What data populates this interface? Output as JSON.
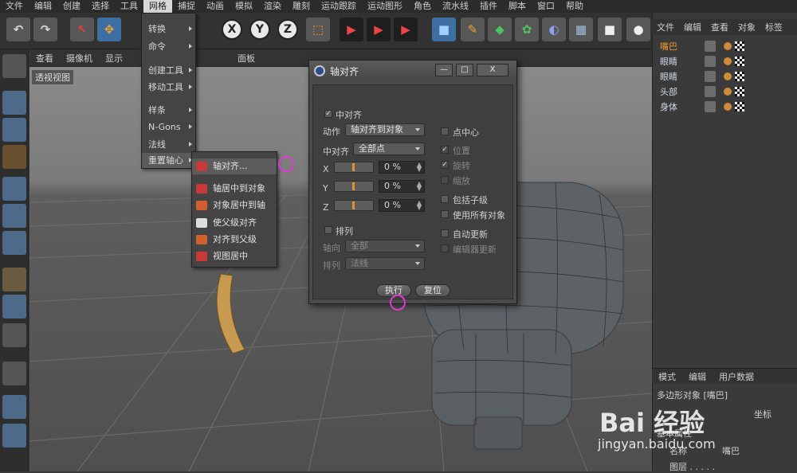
{
  "menubar": [
    "文件",
    "编辑",
    "创建",
    "选择",
    "工具",
    "网格",
    "捕捉",
    "动画",
    "模拟",
    "渲染",
    "雕刻",
    "运动跟踪",
    "运动图形",
    "角色",
    "流水线",
    "插件",
    "脚本",
    "窗口",
    "帮助"
  ],
  "toolbar": {
    "axis_x": "X",
    "axis_y": "Y",
    "axis_z": "Z"
  },
  "viewport": {
    "menu": [
      "查看",
      "摄像机",
      "显示",
      "面板"
    ],
    "label": "透视视图"
  },
  "mesh_menu": {
    "items": [
      "转换",
      "命令",
      "创建工具",
      "移动工具",
      "样条",
      "N-Gons",
      "法线",
      "重置轴心"
    ],
    "active": "重置轴心"
  },
  "submenu": {
    "items": [
      "轴对齐...",
      "轴居中到对象",
      "对象居中到轴",
      "使父级对齐",
      "对齐到父级",
      "视图居中"
    ]
  },
  "dialog": {
    "title": "轴对齐",
    "window_buttons": [
      "—",
      "□",
      "X"
    ],
    "center_align_label": "中对齐",
    "action_label": "动作",
    "action_value": "轴对齐到对象",
    "center_label": "中对齐",
    "center_value": "全部点",
    "x_label": "X",
    "y_label": "Y",
    "z_label": "Z",
    "x_value": "0 %",
    "y_value": "0 %",
    "z_value": "0 %",
    "arrange_label": "排列",
    "axis_label": "轴向",
    "axis_value": "全部",
    "arrange_row_label": "排列",
    "arrange_value": "法线",
    "point_center": "点中心",
    "position": "位置",
    "rotation": "旋转",
    "scale": "缩放",
    "include_children": "包括子级",
    "use_all_objects": "使用所有对象",
    "auto_update": "自动更新",
    "editor_update": "编辑器更新",
    "execute": "执行",
    "reset": "复位"
  },
  "right_panel": {
    "menu": [
      "文件",
      "编辑",
      "查看",
      "对象",
      "标签"
    ],
    "objects": [
      {
        "name": "嘴巴",
        "selected": true
      },
      {
        "name": "眼睛",
        "selected": false
      },
      {
        "name": "眼睛",
        "selected": false
      },
      {
        "name": "头部",
        "selected": false
      },
      {
        "name": "身体",
        "selected": false
      }
    ]
  },
  "attributes": {
    "menu": [
      "模式",
      "编辑",
      "用户数据"
    ],
    "title": "多边形对象 [嘴巴]",
    "tab_coords": "坐标",
    "basic_props": "基本属性",
    "name_label": "名称",
    "name_value": "嘴巴",
    "layer_label": "图层 . . . . ."
  },
  "watermark": {
    "brand": "Bai 经验",
    "url": "jingyan.baidu.com"
  }
}
